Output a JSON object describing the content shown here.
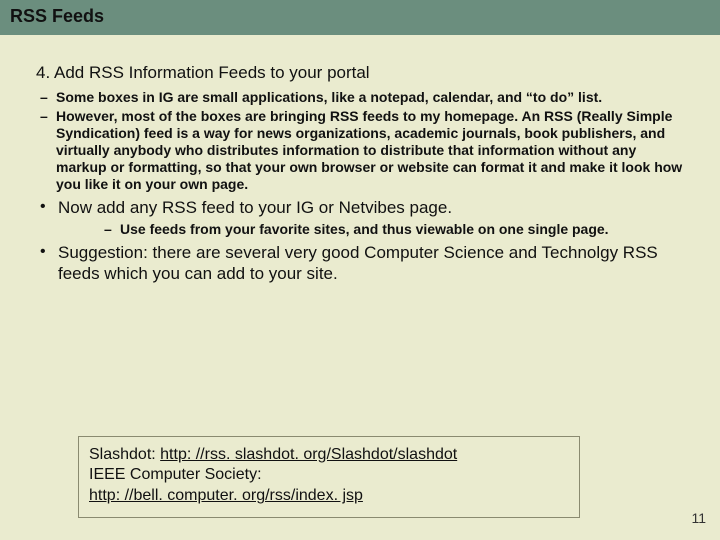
{
  "title": "RSS Feeds",
  "step": {
    "number": "4.",
    "heading": "Add RSS Information Feeds to your portal",
    "sub": [
      "Some boxes in IG are small applications, like a notepad, calendar, and “to do” list.",
      "However, most of the boxes are bringing RSS feeds to my homepage. An RSS (Really Simple Syndication) feed is a way for news organizations, academic journals, book publishers, and virtually anybody who distributes information to distribute that information without any markup or formatting, so that your own browser or website can format it and make it look how you like it on your own page."
    ]
  },
  "bullets": [
    {
      "text": "Now add any RSS feed to your IG or Netvibes page.",
      "sub": [
        "Use feeds from your favorite sites, and thus viewable on one single page."
      ]
    },
    {
      "text": "Suggestion: there are several very good Computer Science and Technolgy RSS feeds which you can add to your site.",
      "sub": []
    }
  ],
  "linkbox": {
    "line1_label": "Slashdot: ",
    "line1_url": "http: //rss. slashdot. org/Slashdot/slashdot",
    "line2_label": "IEEE Computer Society:",
    "line2_url": "http: //bell. computer. org/rss/index. jsp"
  },
  "page_number": "11"
}
